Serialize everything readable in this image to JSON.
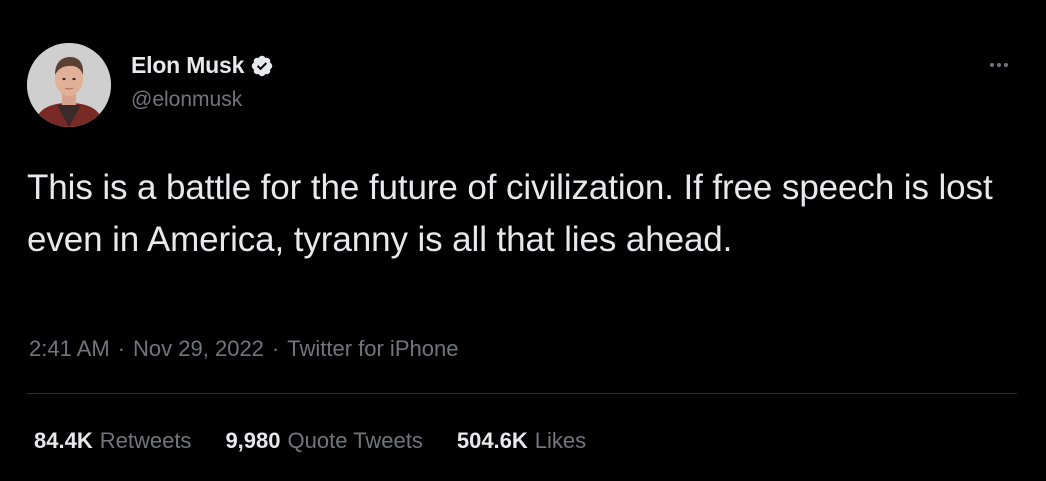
{
  "author": {
    "display_name": "Elon Musk",
    "handle": "@elonmusk",
    "verified_icon": "verified-badge-icon",
    "avatar": "profile-photo"
  },
  "tweet": {
    "text": "This is a battle for the future of civilization. If free speech is lost even in America, tyranny is all that lies ahead.",
    "time": "2:41 AM",
    "separator": "·",
    "date": "Nov 29, 2022",
    "source": "Twitter for iPhone"
  },
  "stats": [
    {
      "count": "84.4K",
      "label": "Retweets"
    },
    {
      "count": "9,980",
      "label": "Quote Tweets"
    },
    {
      "count": "504.6K",
      "label": "Likes"
    }
  ],
  "more_icon": "more-options-icon",
  "colors": {
    "background": "#000000",
    "text": "#e7e9ea",
    "secondary": "#71767b",
    "divider": "#2f3336"
  }
}
